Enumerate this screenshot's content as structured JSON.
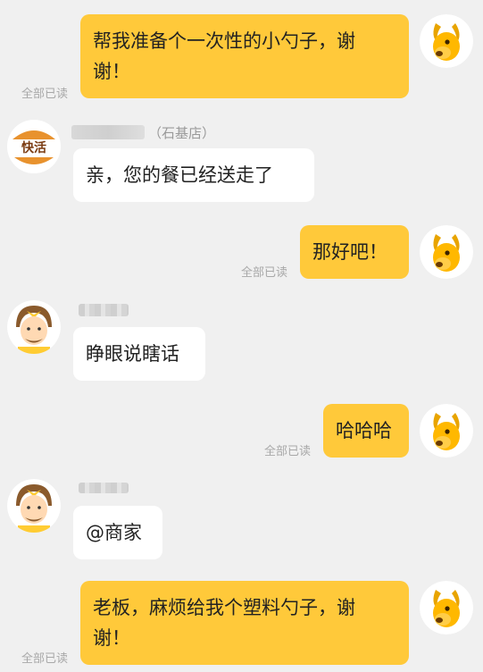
{
  "colors": {
    "outgoing_bubble": "#ffc93a",
    "incoming_bubble": "#ffffff",
    "background": "#f0f0f0",
    "read_status": "#a8a8a8"
  },
  "read_status": "全部已读",
  "store": {
    "logo_text": "快活",
    "name_suffix": "（石基店）"
  },
  "messages": [
    {
      "from": "me",
      "text_line1": "帮我准备个一次性的小勺子，谢",
      "text_line2": "谢！",
      "read": "全部已读"
    },
    {
      "from": "store",
      "text": "亲，您的餐已经送走了"
    },
    {
      "from": "me",
      "text": "那好吧！",
      "read": "全部已读"
    },
    {
      "from": "rider",
      "text": "睁眼说瞎话"
    },
    {
      "from": "me",
      "text": "哈哈哈",
      "read": "全部已读"
    },
    {
      "from": "rider",
      "text": "@商家"
    },
    {
      "from": "me",
      "text_line1": "老板，麻烦给我个塑料勺子，谢",
      "text_line2": "谢！",
      "read": "全部已读"
    }
  ],
  "icons": {
    "me": "yellow-dog-avatar-icon",
    "rider": "delivery-rider-avatar-icon",
    "store": "burger-logo-icon"
  }
}
